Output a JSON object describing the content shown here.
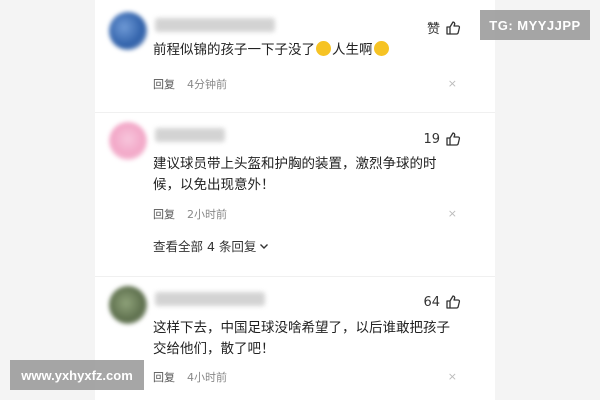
{
  "comments": [
    {
      "like": "赞",
      "text_a": "前程似锦的孩子一下子没了",
      "text_b": "人生啊",
      "reply": "回复",
      "time": "4分钟前",
      "close": "×"
    },
    {
      "like": "19",
      "text": "建议球员带上头盔和护胸的装置，激烈争球的时候，以免出现意外！",
      "reply": "回复",
      "time": "2小时前",
      "close": "×",
      "see_all": "查看全部 4 条回复"
    },
    {
      "like": "64",
      "text": "这样下去，中国足球没啥希望了，以后谁敢把孩子交给他们，散了吧！",
      "reply": "回复",
      "time": "4小时前",
      "close": "×"
    }
  ],
  "watermarks": {
    "top_right": "TG: MYYJJPP",
    "bottom_left": "www.yxhyxfz.com"
  },
  "colors": {
    "page_bg": "#f4f4f4",
    "panel_bg": "#ffffff",
    "watermark_bg": "#969696"
  }
}
